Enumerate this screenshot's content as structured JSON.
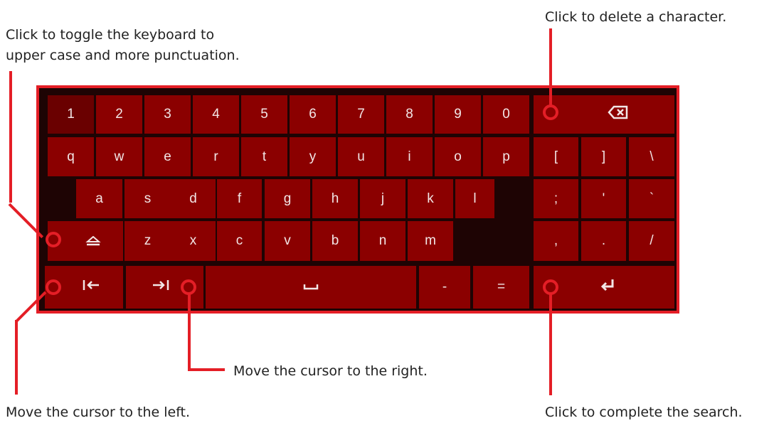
{
  "callouts": {
    "shift_line1": "Click to toggle the keyboard to",
    "shift_line2": "upper case and more punctuation.",
    "delete": "Click to delete a character.",
    "cursor_right": "Move the cursor to the right.",
    "cursor_left": "Move the cursor to the left.",
    "enter": "Click to complete the search."
  },
  "keys": {
    "row1": [
      "1",
      "2",
      "3",
      "4",
      "5",
      "6",
      "7",
      "8",
      "9",
      "0"
    ],
    "row2": [
      "q",
      "w",
      "e",
      "r",
      "t",
      "y",
      "u",
      "i",
      "o",
      "p"
    ],
    "row3": [
      "a",
      "s",
      "d",
      "f",
      "g",
      "h",
      "j",
      "k",
      "l"
    ],
    "row4": [
      "z",
      "x",
      "c",
      "v",
      "b",
      "n",
      "m"
    ],
    "minus": "-",
    "equals": "=",
    "punct": [
      "[",
      "]",
      "\\",
      ";",
      "'",
      "`",
      ",",
      ".",
      "/"
    ]
  },
  "icons": {
    "backspace": "backspace-icon",
    "shift": "shift-icon",
    "cursor_left": "cursor-left-icon",
    "cursor_right": "cursor-right-icon",
    "space": "space-icon",
    "enter": "enter-icon"
  },
  "colors": {
    "accent": "#e41e26",
    "key": "#8b0000",
    "key_focused": "#6a0000",
    "text": "#f2e6e6"
  }
}
